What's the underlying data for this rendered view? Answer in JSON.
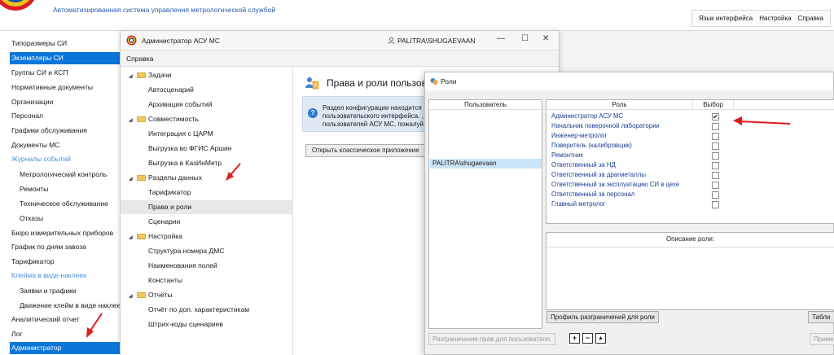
{
  "header": {
    "title": "Автоматизированная система управления метрологической службой",
    "menu": [
      "Язык интерфейса",
      "Настройка",
      "Справка"
    ]
  },
  "nav": {
    "items": [
      {
        "label": "Типоразмеры СИ",
        "kind": "item"
      },
      {
        "label": "Экземпляры СИ",
        "kind": "active"
      },
      {
        "label": "Группы СИ и КСП",
        "kind": "item"
      },
      {
        "label": "Нормативные документы",
        "kind": "item"
      },
      {
        "label": "Организации",
        "kind": "item"
      },
      {
        "label": "Персонал",
        "kind": "item"
      },
      {
        "label": "Графики обслуживания",
        "kind": "item"
      },
      {
        "label": "Документы МС",
        "kind": "item"
      },
      {
        "label": "Журналы событий",
        "kind": "section"
      },
      {
        "label": "Метрологический контроль",
        "kind": "sub"
      },
      {
        "label": "Ремонты",
        "kind": "sub"
      },
      {
        "label": "Техническое обслуживание",
        "kind": "sub"
      },
      {
        "label": "Отказы",
        "kind": "sub"
      },
      {
        "label": "Бюро измерительных приборов",
        "kind": "item"
      },
      {
        "label": "График по дням завоза",
        "kind": "item"
      },
      {
        "label": "Тарификатор",
        "kind": "item"
      },
      {
        "label": "Клейма в виде наклеек",
        "kind": "section"
      },
      {
        "label": "Заявки и графики",
        "kind": "sub"
      },
      {
        "label": "Движение клейм в виде наклеек",
        "kind": "sub"
      },
      {
        "label": "Аналитический отчет",
        "kind": "item"
      },
      {
        "label": "Лог",
        "kind": "item"
      },
      {
        "label": "Администратор",
        "kind": "active"
      }
    ]
  },
  "admin_window": {
    "title": "Администратор АСУ МС",
    "user": "PALITRA\\SHUGAEVAAN",
    "minimize": "—",
    "maximize": "☐",
    "close": "✕",
    "menu": "Справка",
    "tree": [
      {
        "label": "Задачи",
        "type": "folder"
      },
      {
        "label": "Автосценарий",
        "type": "leaf"
      },
      {
        "label": "Архивация событий",
        "type": "leaf"
      },
      {
        "label": "Совместимость",
        "type": "folder"
      },
      {
        "label": "Интеграция с ЦАРМ",
        "type": "leaf"
      },
      {
        "label": "Выгрузка во ФГИС Аршин",
        "type": "leaf"
      },
      {
        "label": "Выгрузка в КазИнМетр",
        "type": "leaf"
      },
      {
        "label": "Разделы данных",
        "type": "folder"
      },
      {
        "label": "Тарификатор",
        "type": "leaf"
      },
      {
        "label": "Права и роли",
        "type": "leaf",
        "selected": true
      },
      {
        "label": "Сценарии",
        "type": "leaf"
      },
      {
        "label": "Настройка",
        "type": "folder"
      },
      {
        "label": "Структура номера ДМС",
        "type": "leaf"
      },
      {
        "label": "Наименования полей",
        "type": "leaf"
      },
      {
        "label": "Константы",
        "type": "leaf"
      },
      {
        "label": "Отчёты",
        "type": "folder"
      },
      {
        "label": "Отчёт по доп. характеристикам",
        "type": "leaf"
      },
      {
        "label": "Штрих-коды сценариев",
        "type": "leaf"
      }
    ],
    "panel_title": "Права и роли пользовате",
    "info_lines": [
      "Раздел конфигурации находится",
      "пользовательского интерфейса. ,",
      "пользователей АСУ МС, пожалуй"
    ],
    "open_button": "Открыть классическое приложение"
  },
  "roles_window": {
    "title": "Роли",
    "users_header": "Пользователь",
    "users": [
      "PALITRA\\shugaevaan"
    ],
    "roles_header": "Роль",
    "select_header": "Выбор",
    "roles": [
      {
        "name": "Администратор АСУ МС",
        "checked": true
      },
      {
        "name": "Начальник поверочной лаборатории",
        "checked": false
      },
      {
        "name": "Инженер-метролог",
        "checked": false
      },
      {
        "name": "Поверитель (калибровщик)",
        "checked": false
      },
      {
        "name": "Ремонтник",
        "checked": false
      },
      {
        "name": "Ответственный за НД",
        "checked": false
      },
      {
        "name": "Ответственный за драгметаллы",
        "checked": false
      },
      {
        "name": "Ответственный за эксплуатацию СИ в цехе",
        "checked": false
      },
      {
        "name": "Ответственный за персонал",
        "checked": false
      },
      {
        "name": "Главный метролог",
        "checked": false
      }
    ],
    "check_mark": "✔",
    "description_header": "Описание роли:",
    "profile_button": "Профиль разграничений для роли",
    "tables_button": "Табли",
    "restrict_button": "Разграничение прав для пользователя",
    "add_symbol": "+",
    "remove_symbol": "−",
    "up_symbol": "▲",
    "apply_button": "Приме"
  },
  "colors": {
    "accent": "#0a76d8",
    "annotation_arrow": "#e21b1b",
    "link_blue": "#2a5cad"
  }
}
